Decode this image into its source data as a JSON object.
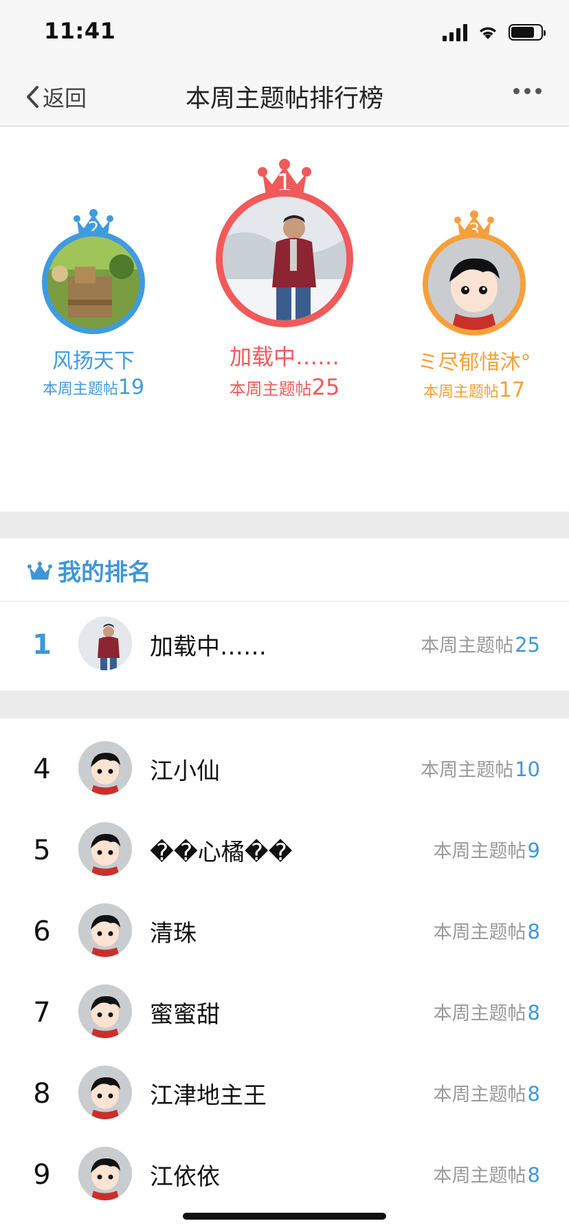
{
  "status": {
    "time": "11:41"
  },
  "nav": {
    "back_label": "返回",
    "title": "本周主题帖排行榜"
  },
  "podium": {
    "count_label": "本周主题帖",
    "first": {
      "rank": "1",
      "name": "加载中……",
      "count": "25",
      "color": "#f05a5a"
    },
    "second": {
      "rank": "2",
      "name": "风扬天下",
      "count": "19",
      "color": "#3f9be0"
    },
    "third": {
      "rank": "3",
      "name": "ミ尽郁惜沐°",
      "count": "17",
      "color": "#f5a03a"
    }
  },
  "my_ranking": {
    "header": "我的排名",
    "rank": "1",
    "name": "加载中……",
    "count_label": "本周主题帖",
    "count": "25"
  },
  "list": {
    "count_label": "本周主题帖",
    "rows": [
      {
        "rank": "4",
        "name": "江小仙",
        "count": "10"
      },
      {
        "rank": "5",
        "name": "��心橘��",
        "count": "9"
      },
      {
        "rank": "6",
        "name": "清珠",
        "count": "8"
      },
      {
        "rank": "7",
        "name": "蜜蜜甜",
        "count": "8"
      },
      {
        "rank": "8",
        "name": "江津地主王",
        "count": "8"
      },
      {
        "rank": "9",
        "name": "江依依",
        "count": "8"
      }
    ]
  },
  "icons": {
    "back": "chevron-left-icon",
    "more": "more-dots-icon",
    "crown": "crown-icon",
    "signal": "signal-icon",
    "wifi": "wifi-icon",
    "battery": "battery-icon"
  },
  "colors": {
    "accent": "#3f96d6",
    "first": "#f05a5a",
    "second": "#3f9be0",
    "third": "#f5a03a"
  }
}
